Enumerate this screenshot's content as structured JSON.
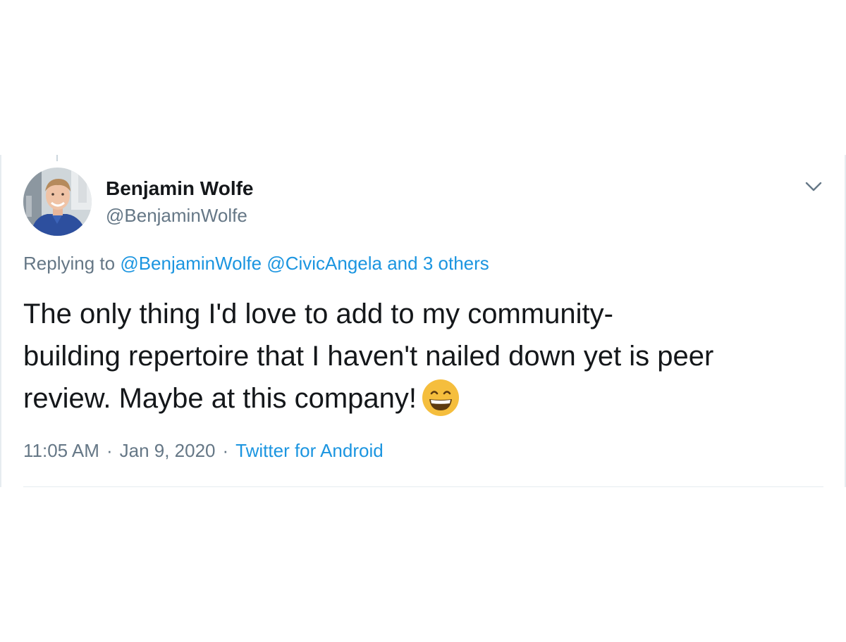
{
  "author": {
    "name": "Benjamin Wolfe",
    "handle": "@BenjaminWolfe"
  },
  "reply": {
    "prefix": "Replying to",
    "mentions": "@BenjaminWolfe @CivicAngela and 3 others"
  },
  "tweet": {
    "line1": "The only thing I'd love to add to my community-",
    "line2": "building repertoire that I haven't nailed down yet is peer",
    "line3": "review. Maybe at this company!",
    "emoji": "grinning-squinting-face"
  },
  "meta": {
    "time": "11:05 AM",
    "date": "Jan 9, 2020",
    "separator": "·",
    "source": "Twitter for Android"
  },
  "colors": {
    "link": "#1b95e0",
    "secondary_text": "#657786",
    "primary_text": "#14171a",
    "border": "#e6ecf0"
  },
  "icons": {
    "more": "chevron-down-icon"
  }
}
